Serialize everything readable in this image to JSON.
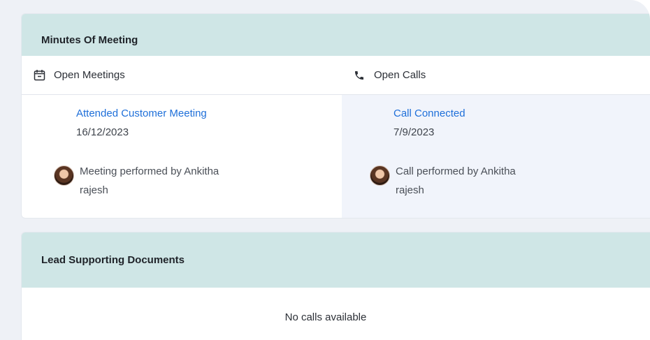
{
  "minutes": {
    "title": "Minutes Of Meeting",
    "meetings": {
      "heading": "Open Meetings",
      "icon": "calendar-icon",
      "entry": {
        "title": "Attended Customer Meeting",
        "date": "16/12/2023",
        "performed_by": "Meeting performed by Ankitha rajesh"
      }
    },
    "calls": {
      "heading": "Open Calls",
      "icon": "phone-icon",
      "entry": {
        "title": "Call Connected",
        "date": "7/9/2023",
        "performed_by": "Call performed by Ankitha rajesh"
      }
    }
  },
  "documents": {
    "title": "Lead Supporting Documents",
    "empty_message": "No calls available"
  },
  "colors": {
    "header_bg": "#cfe6e6",
    "link": "#1e6fd9",
    "calls_bg": "#f1f4fb",
    "page_bg": "#eef1f6"
  }
}
